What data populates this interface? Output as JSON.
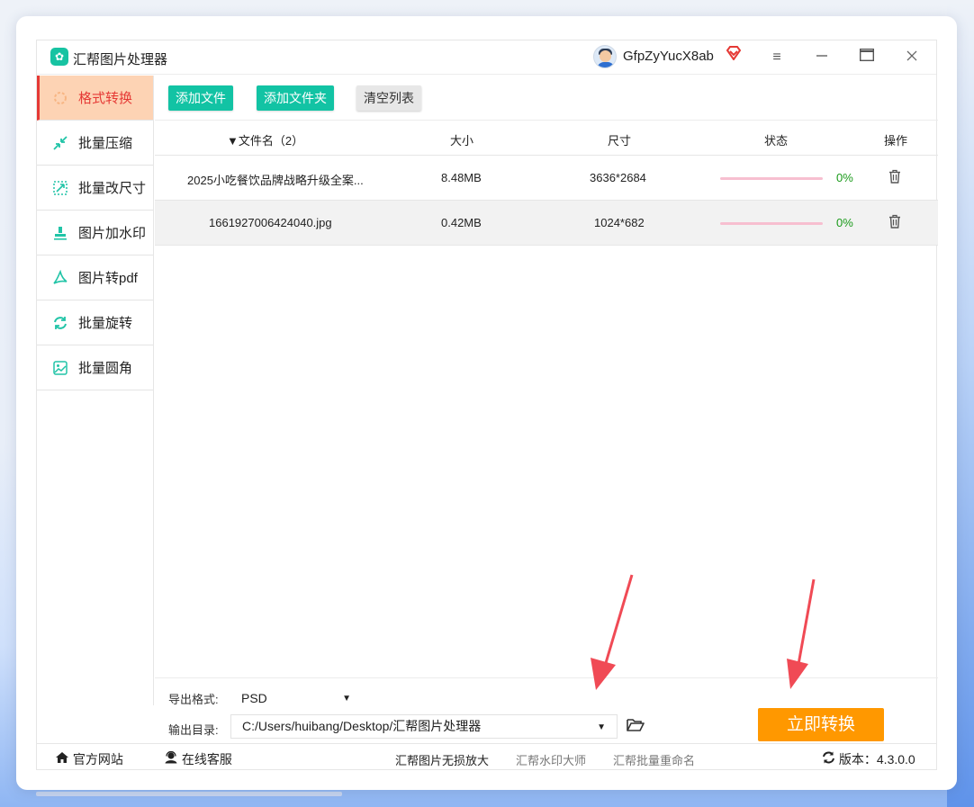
{
  "app": {
    "title": "汇帮图片处理器",
    "username": "GfpZyYucX8ab"
  },
  "window_controls": {
    "menu": "≡",
    "minimize": "—",
    "maximize": "▭",
    "close": "×"
  },
  "sidebar": {
    "items": [
      {
        "label": "格式转换",
        "icon": "format-convert-icon",
        "active": true
      },
      {
        "label": "批量压缩",
        "icon": "compress-icon",
        "active": false
      },
      {
        "label": "批量改尺寸",
        "icon": "resize-icon",
        "active": false
      },
      {
        "label": "图片加水印",
        "icon": "watermark-icon",
        "active": false
      },
      {
        "label": "图片转pdf",
        "icon": "pdf-icon",
        "active": false
      },
      {
        "label": "批量旋转",
        "icon": "rotate-icon",
        "active": false
      },
      {
        "label": "批量圆角",
        "icon": "round-corner-icon",
        "active": false
      }
    ]
  },
  "toolbar": {
    "add_file": "添加文件",
    "add_folder": "添加文件夹",
    "clear_list": "清空列表"
  },
  "table": {
    "headers": {
      "filename": "▼文件名（2）",
      "size": "大小",
      "dimensions": "尺寸",
      "status": "状态",
      "actions": "操作"
    },
    "rows": [
      {
        "filename": "2025小吃餐饮品牌战略升级全案...",
        "size": "8.48MB",
        "dimensions": "3636*2684",
        "progress": "0%"
      },
      {
        "filename": "1661927006424040.jpg",
        "size": "0.42MB",
        "dimensions": "1024*682",
        "progress": "0%"
      }
    ]
  },
  "settings": {
    "format_label": "导出格式:",
    "format_value": "PSD",
    "output_label": "输出目录:",
    "output_value": "C:/Users/huibang/Desktop/汇帮图片处理器"
  },
  "convert_button": "立即转换",
  "footer": {
    "website": "官方网站",
    "support": "在线客服",
    "link1": "汇帮图片无损放大",
    "link2": "汇帮水印大师",
    "link3": "汇帮批量重命名",
    "version_label": "版本：",
    "version": "4.3.0.0"
  },
  "colors": {
    "accent": "#12c3a4",
    "active_bg": "#fdd3b4",
    "active_text": "#e53935",
    "convert": "#ff9800",
    "arrow": "#f04a55"
  }
}
